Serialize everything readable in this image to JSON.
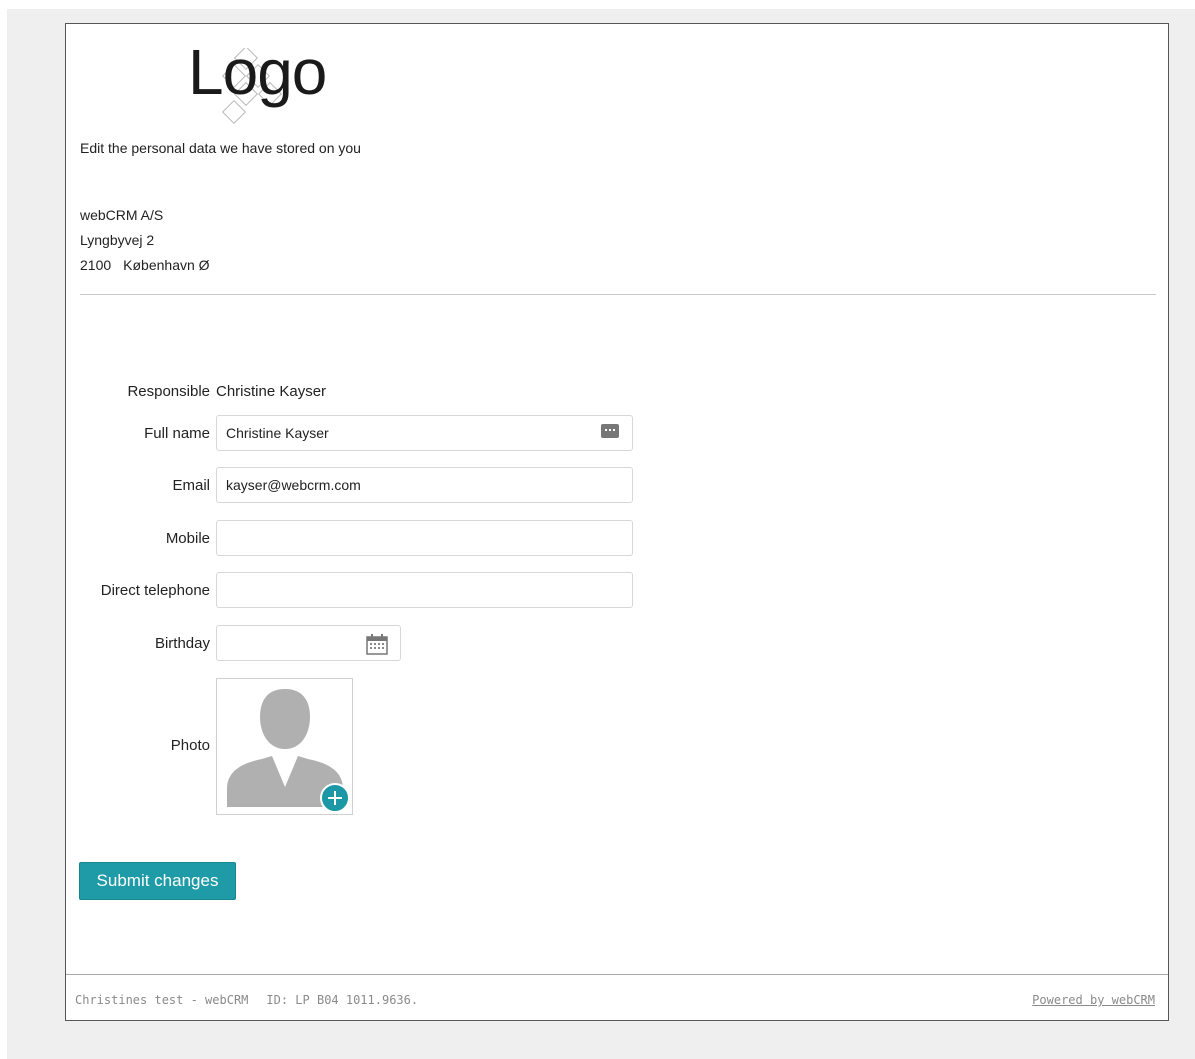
{
  "header": {
    "logo_text": "Logo",
    "intro": "Edit the personal data we have stored on you"
  },
  "company": {
    "name": "webCRM A/S",
    "street": "Lyngbyvej 2",
    "zip": "2100",
    "city": "København Ø"
  },
  "form": {
    "responsible_label": "Responsible",
    "responsible_value": "Christine Kayser",
    "full_name_label": "Full name",
    "full_name_value": "Christine Kayser",
    "email_label": "Email",
    "email_value": "kayser@webcrm.com",
    "mobile_label": "Mobile",
    "mobile_value": "",
    "direct_phone_label": "Direct telephone",
    "direct_phone_value": "",
    "birthday_label": "Birthday",
    "birthday_value": "",
    "photo_label": "Photo",
    "submit_label": "Submit changes"
  },
  "icons": {
    "full_name_action": "more-dots-icon",
    "birthday": "calendar-icon",
    "photo": "avatar-placeholder-icon",
    "photo_add": "plus-circle-icon"
  },
  "colors": {
    "accent": "#1f9aa7"
  },
  "footer": {
    "title": "Christines test - webCRM",
    "id": "ID: LP B04 1011.9636.",
    "powered": "Powered by webCRM"
  }
}
